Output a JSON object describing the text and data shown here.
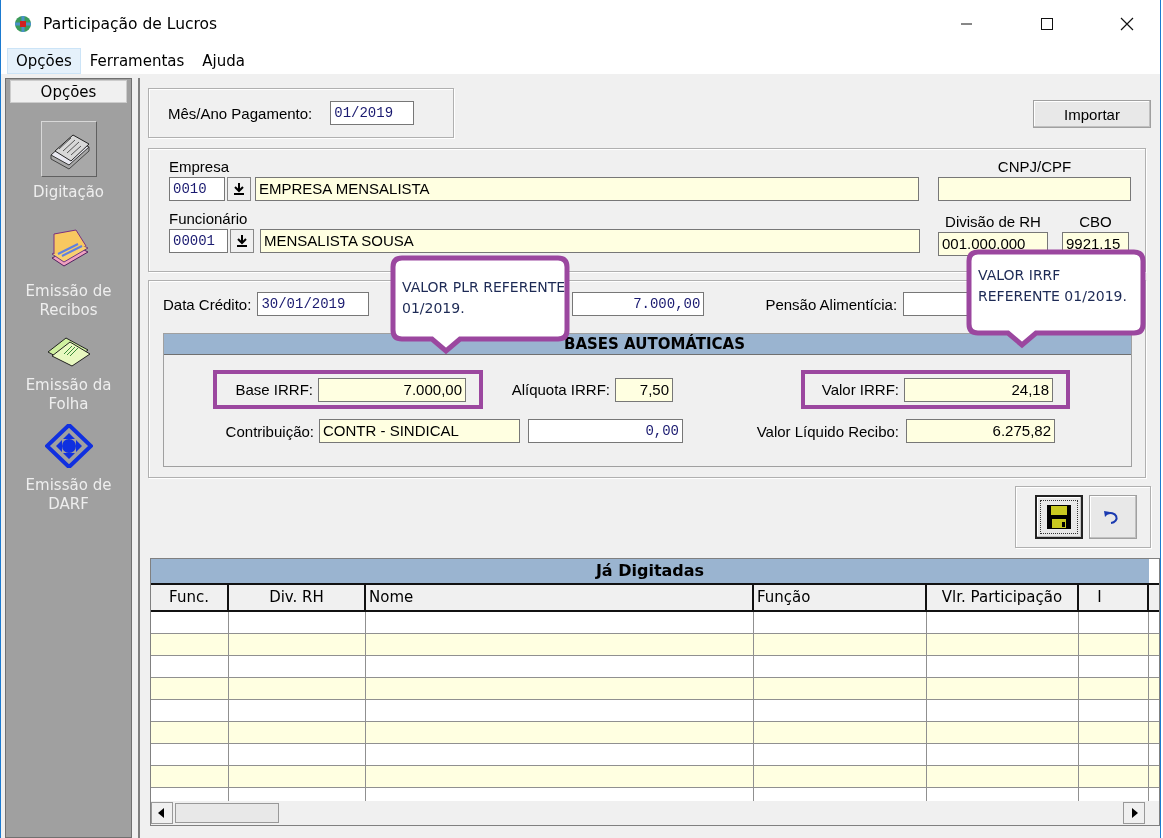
{
  "window": {
    "title": "Participação de Lucros"
  },
  "menu": [
    {
      "label": "Opções",
      "selected": true
    },
    {
      "label": "Ferramentas",
      "selected": false
    },
    {
      "label": "Ajuda",
      "selected": false
    }
  ],
  "sidebar": {
    "header": "Opções",
    "items": [
      {
        "label": "Digitação",
        "selected": true
      },
      {
        "label": "Emissão de Recibos",
        "selected": false
      },
      {
        "label": "Emissão da Folha",
        "selected": false
      },
      {
        "label": "Emissão de DARF",
        "selected": false
      }
    ]
  },
  "payment": {
    "label": "Mês/Ano Pagamento:",
    "value": "01/2019"
  },
  "import_button": "Importar",
  "company": {
    "label": "Empresa",
    "code": "0010",
    "name": "EMPRESA MENSALISTA"
  },
  "cnpj": {
    "label": "CNPJ/CPF"
  },
  "employee": {
    "label": "Funcionário",
    "code": "00001",
    "name": "MENSALISTA SOUSA"
  },
  "division": {
    "label": "Divisão de RH",
    "value": "001.000.000"
  },
  "cbo": {
    "label": "CBO",
    "value": "9921.15"
  },
  "credit": {
    "date_label": "Data Crédito:",
    "date": "30/01/2019",
    "amount": "7.000,00",
    "alimony_label": "Pensão Alimentícia:"
  },
  "bases": {
    "title": "BASES AUTOMÁTICAS",
    "base_irrf": {
      "label": "Base IRRF:",
      "value": "7.000,00",
      "highlighted": true
    },
    "rate": {
      "label": "Alíquota IRRF:",
      "value": "7,50"
    },
    "irrf": {
      "label": "Valor IRRF:",
      "value": "24,18",
      "highlighted": true
    },
    "contribution": {
      "label": "Contribuição:",
      "value": "CONTR - SINDICAL",
      "amount": "0,00"
    },
    "net": {
      "label": "Valor Líquido Recibo:",
      "value": "6.275,82"
    }
  },
  "callouts": [
    {
      "text": "VALOR PLR REFERENTE 01/2019."
    },
    {
      "text": "VALOR IRRF REFERENTE 01/2019."
    }
  ],
  "table": {
    "title": "Já Digitadas",
    "columns": [
      "Func.",
      "Div. RH",
      "Nome",
      "Função",
      "Vlr. Participação",
      "I"
    ]
  }
}
